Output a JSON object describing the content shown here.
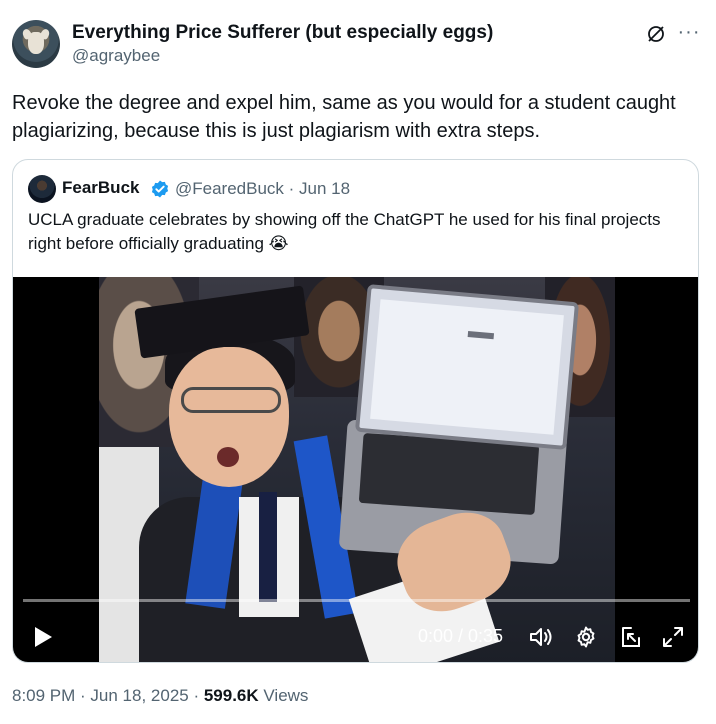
{
  "author": {
    "name": "Everything Price Sufferer (but especially eggs)",
    "handle": "@agraybee"
  },
  "tweet": {
    "text": "Revoke the degree and expel him, same as you would for a student caught plagiarizing, because this is just plagiarism with extra steps."
  },
  "header_icons": {
    "grok": "grok-icon",
    "more": "more-icon",
    "more_glyph": "···"
  },
  "quote": {
    "name": "FearBuck",
    "handle_date": "@FearedBuck · Jun 18",
    "text": "UCLA graduate celebrates by showing off the ChatGPT he used for his final projects right before officially graduating 😭",
    "verified_color": "#1d9bf0"
  },
  "video": {
    "time": "0:00 / 0:35",
    "progress": 0.0,
    "controls": [
      "play-icon",
      "volume-icon",
      "settings-icon",
      "picture-in-picture-icon",
      "expand-icon"
    ]
  },
  "footer": {
    "time_date": "8:09 PM · Jun 18, 2025 · ",
    "views_count": "599.6K",
    "views_label": " Views"
  },
  "colors": {
    "text_primary": "#0f1419",
    "text_secondary": "#536471",
    "border": "#cfd9de"
  }
}
